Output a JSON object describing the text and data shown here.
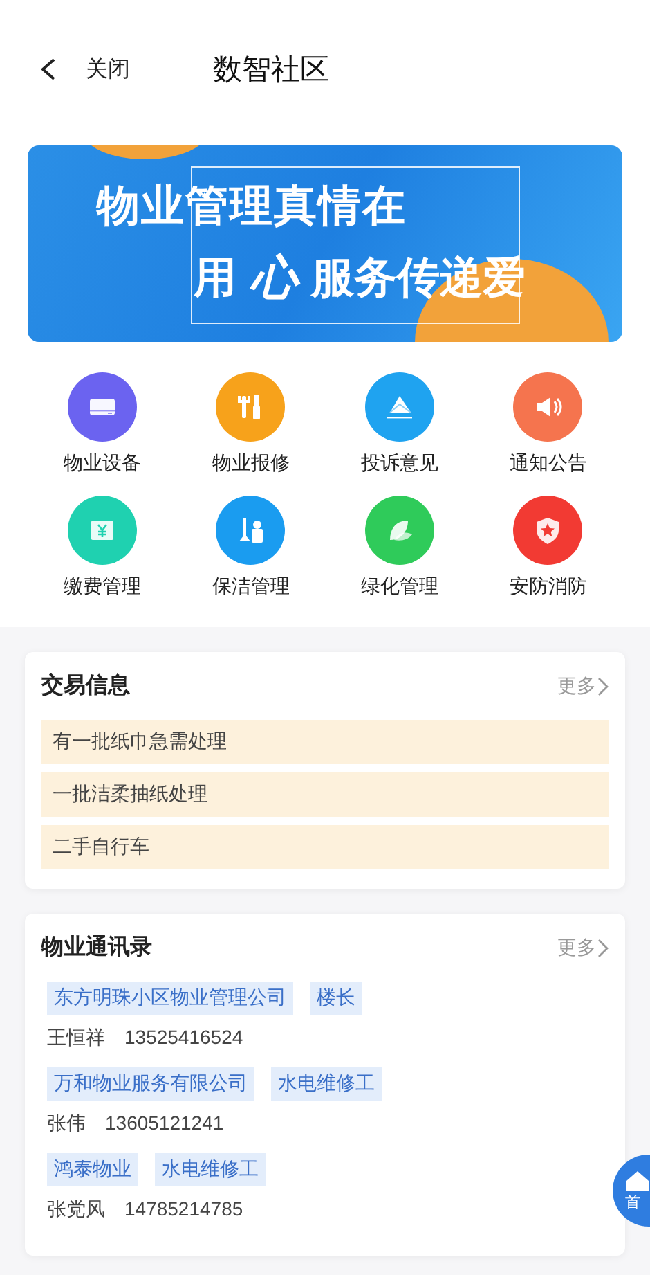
{
  "header": {
    "back_label": "关闭",
    "title": "数智社区"
  },
  "banner": {
    "line_1": "物业管理真情在",
    "line_2_start": "用",
    "line_2_mark": "心",
    "line_2_end": "服务传递爱"
  },
  "services": [
    {
      "label": "物业设备",
      "kind": "device",
      "color": "#6b63f0"
    },
    {
      "label": "物业报修",
      "kind": "tools",
      "color": "#f7a21b"
    },
    {
      "label": "投诉意见",
      "kind": "envelope",
      "color": "#1fa3f0"
    },
    {
      "label": "通知公告",
      "kind": "speaker",
      "color": "#f5744e"
    },
    {
      "label": "缴费管理",
      "kind": "payment",
      "color": "#1fd1b0"
    },
    {
      "label": "保洁管理",
      "kind": "cleaning",
      "color": "#1a9cf0"
    },
    {
      "label": "绿化管理",
      "kind": "leaf",
      "color": "#2fcb5a"
    },
    {
      "label": "安防消防",
      "kind": "shield",
      "color": "#f23a33"
    }
  ],
  "trade": {
    "title": "交易信息",
    "more": "更多",
    "items": [
      "有一批纸巾急需处理",
      "一批洁柔抽纸处理",
      "二手自行车"
    ]
  },
  "directory": {
    "title": "物业通讯录",
    "more": "更多",
    "contacts": [
      {
        "tags": [
          "东方明珠小区物业管理公司",
          "楼长"
        ],
        "name": "王恒祥",
        "phone": "13525416524"
      },
      {
        "tags": [
          "万和物业服务有限公司",
          "水电维修工"
        ],
        "name": "张伟",
        "phone": "13605121241"
      },
      {
        "tags": [
          "鸿泰物业",
          "水电维修工"
        ],
        "name": "张党风",
        "phone": "14785214785"
      }
    ]
  },
  "home_button": {
    "label": "首"
  }
}
